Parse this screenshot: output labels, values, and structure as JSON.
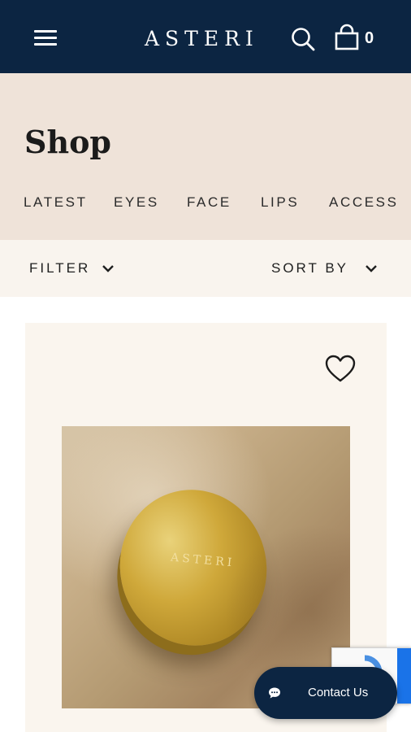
{
  "header": {
    "logo": "ASTERI",
    "cart_count": "0",
    "icons": {
      "menu": "hamburger-menu-icon",
      "search": "search-icon",
      "cart": "shopping-bag-icon"
    },
    "background": "#0c2542"
  },
  "shop": {
    "title": "Shop",
    "categories": [
      "LATEST",
      "EYES",
      "FACE",
      "LIPS",
      "ACCESS"
    ],
    "background": "#efe3d9"
  },
  "filter_bar": {
    "filter_label": "FILTER",
    "sort_label": "SORT BY",
    "icons": {
      "dropdown": "chevron-down-icon"
    }
  },
  "product_card": {
    "image_logo": "ASTERI",
    "icons": {
      "wishlist": "heart-outline-icon"
    }
  },
  "chat_widget": {
    "label": "Contact Us",
    "icons": {
      "chat": "chat-bubble-icon"
    }
  },
  "recaptcha": {
    "icons": {
      "badge": "recaptcha-icon"
    }
  }
}
